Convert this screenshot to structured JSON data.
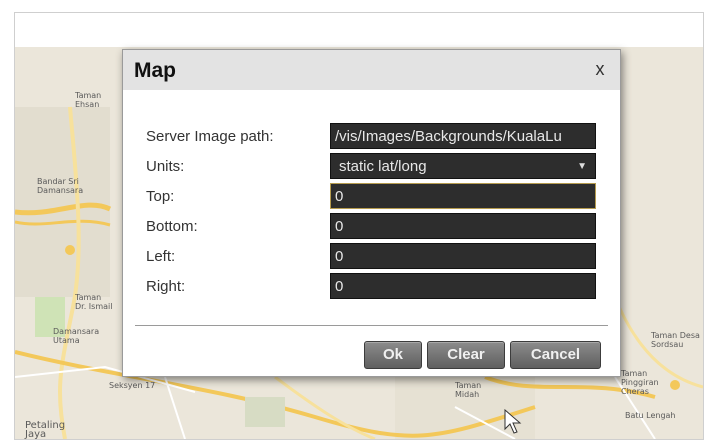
{
  "dialog": {
    "title": "Map",
    "close_label": "x",
    "fields": {
      "server_image_path": {
        "label": "Server Image path:",
        "value": "/vis/Images/Backgrounds/KualaLu"
      },
      "units": {
        "label": "Units:",
        "value": "static lat/long"
      },
      "top": {
        "label": "Top:",
        "value": "0"
      },
      "bottom": {
        "label": "Bottom:",
        "value": "0"
      },
      "left": {
        "label": "Left:",
        "value": "0"
      },
      "right": {
        "label": "Right:",
        "value": "0"
      }
    },
    "buttons": {
      "ok": "Ok",
      "clear": "Clear",
      "cancel": "Cancel"
    }
  },
  "map": {
    "labels": {
      "taman_ehsan": "Taman\nEhsan",
      "bandar_sri_damansara": "Bandar Sri\nDamansara",
      "taman_tun": "Taman\nTun Dr\nIsmail",
      "damansara_utama": "Damansara\nUtama",
      "taman_desa": "Taman Desa\nSordsau",
      "petaling_jaya": "Petaling\nJaya",
      "pinggiran": "Taman\nPinggiran\nCheras",
      "seksyen": "Seksyen 17",
      "taman_midah": "Taman\nMidah",
      "batu_lengah": "Batu Lengah"
    }
  }
}
